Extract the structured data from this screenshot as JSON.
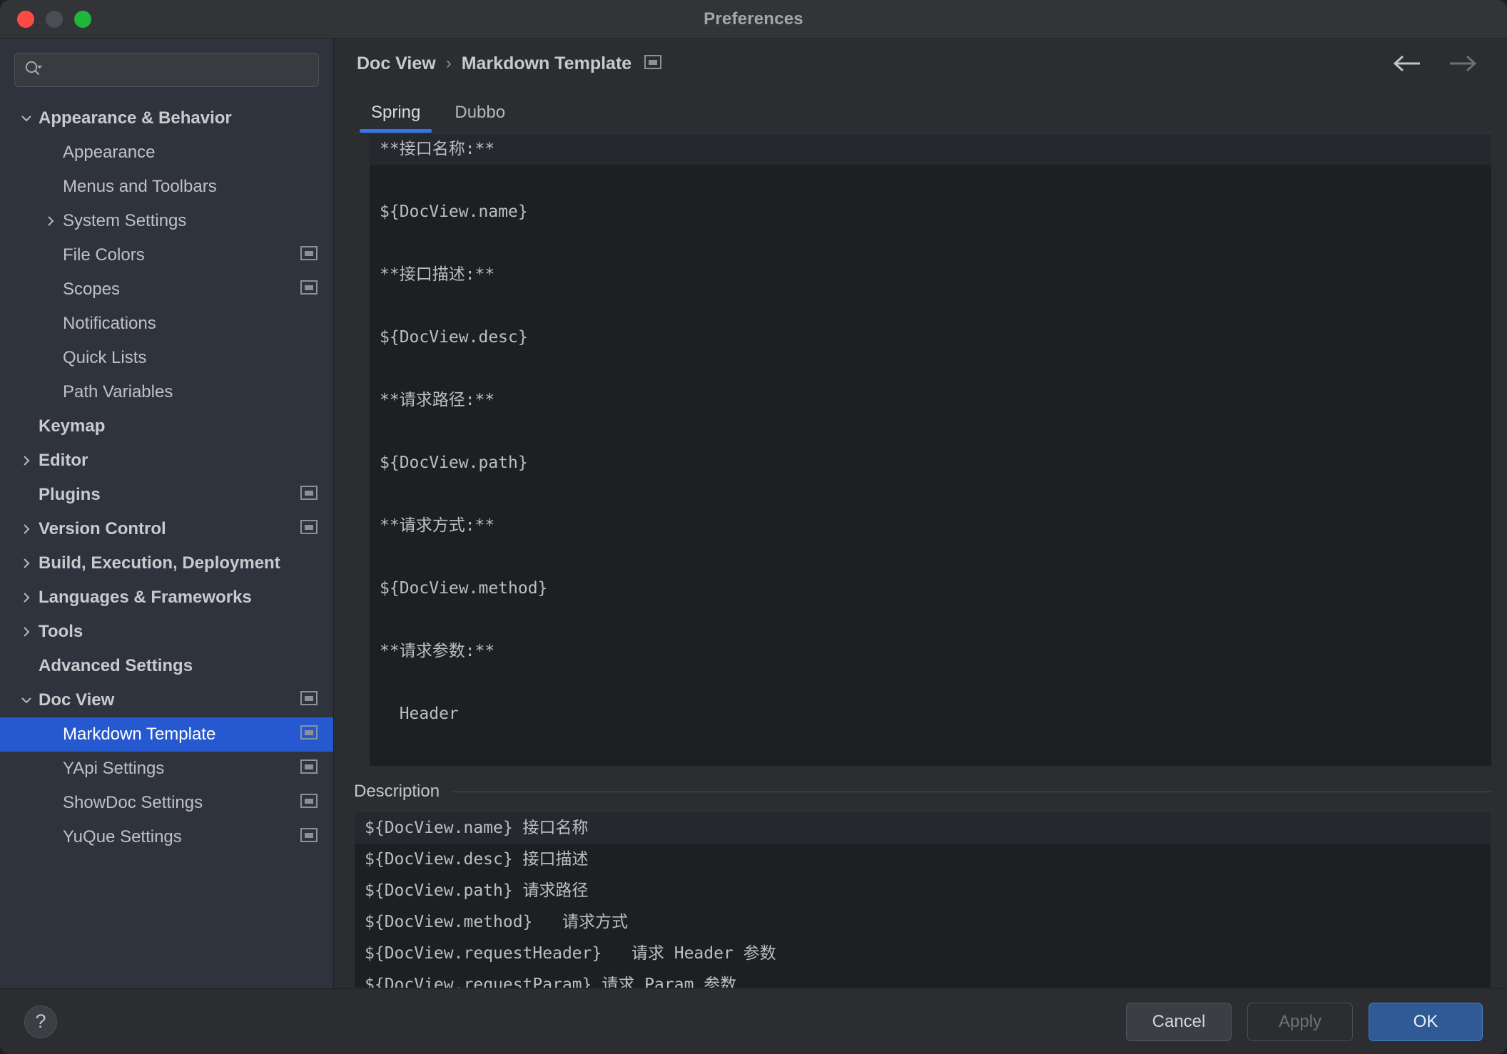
{
  "window": {
    "title": "Preferences",
    "traffic_lights": [
      "close",
      "minimize",
      "maximize"
    ]
  },
  "sidebar": {
    "search": {
      "value": "",
      "placeholder": ""
    },
    "items": [
      {
        "label": "Appearance & Behavior",
        "depth": 0,
        "chevron": "down",
        "icon": false,
        "selected": false
      },
      {
        "label": "Appearance",
        "depth": 1,
        "chevron": "none",
        "icon": false,
        "selected": false
      },
      {
        "label": "Menus and Toolbars",
        "depth": 1,
        "chevron": "none",
        "icon": false,
        "selected": false
      },
      {
        "label": "System Settings",
        "depth": 1,
        "chevron": "right",
        "icon": false,
        "selected": false
      },
      {
        "label": "File Colors",
        "depth": 1,
        "chevron": "none",
        "icon": true,
        "selected": false
      },
      {
        "label": "Scopes",
        "depth": 1,
        "chevron": "none",
        "icon": true,
        "selected": false
      },
      {
        "label": "Notifications",
        "depth": 1,
        "chevron": "none",
        "icon": false,
        "selected": false
      },
      {
        "label": "Quick Lists",
        "depth": 1,
        "chevron": "none",
        "icon": false,
        "selected": false
      },
      {
        "label": "Path Variables",
        "depth": 1,
        "chevron": "none",
        "icon": false,
        "selected": false
      },
      {
        "label": "Keymap",
        "depth": 0,
        "chevron": "none",
        "icon": false,
        "selected": false
      },
      {
        "label": "Editor",
        "depth": 0,
        "chevron": "right",
        "icon": false,
        "selected": false
      },
      {
        "label": "Plugins",
        "depth": 0,
        "chevron": "none",
        "icon": true,
        "selected": false
      },
      {
        "label": "Version Control",
        "depth": 0,
        "chevron": "right",
        "icon": true,
        "selected": false
      },
      {
        "label": "Build, Execution, Deployment",
        "depth": 0,
        "chevron": "right",
        "icon": false,
        "selected": false
      },
      {
        "label": "Languages & Frameworks",
        "depth": 0,
        "chevron": "right",
        "icon": false,
        "selected": false
      },
      {
        "label": "Tools",
        "depth": 0,
        "chevron": "right",
        "icon": false,
        "selected": false
      },
      {
        "label": "Advanced Settings",
        "depth": 0,
        "chevron": "none",
        "icon": false,
        "selected": false
      },
      {
        "label": "Doc View",
        "depth": 0,
        "chevron": "down",
        "icon": true,
        "selected": false
      },
      {
        "label": "Markdown Template",
        "depth": 1,
        "chevron": "none",
        "icon": true,
        "selected": true
      },
      {
        "label": "YApi Settings",
        "depth": 1,
        "chevron": "none",
        "icon": true,
        "selected": false
      },
      {
        "label": "ShowDoc Settings",
        "depth": 1,
        "chevron": "none",
        "icon": true,
        "selected": false
      },
      {
        "label": "YuQue Settings",
        "depth": 1,
        "chevron": "none",
        "icon": true,
        "selected": false
      }
    ]
  },
  "breadcrumb": {
    "root": "Doc View",
    "separator": "›",
    "leaf": "Markdown Template",
    "back_arrow": "←",
    "forward_arrow": "→"
  },
  "tabs": [
    {
      "label": "Spring",
      "active": true
    },
    {
      "label": "Dubbo",
      "active": false
    }
  ],
  "editor": {
    "lines": [
      {
        "text": "**接口名称:**",
        "current": true
      },
      {
        "text": "",
        "current": false
      },
      {
        "text": "${DocView.name}",
        "current": false
      },
      {
        "text": "",
        "current": false
      },
      {
        "text": "**接口描述:**",
        "current": false
      },
      {
        "text": "",
        "current": false
      },
      {
        "text": "${DocView.desc}",
        "current": false
      },
      {
        "text": "",
        "current": false
      },
      {
        "text": "**请求路径:**",
        "current": false
      },
      {
        "text": "",
        "current": false
      },
      {
        "text": "${DocView.path}",
        "current": false
      },
      {
        "text": "",
        "current": false
      },
      {
        "text": "**请求方式:**",
        "current": false
      },
      {
        "text": "",
        "current": false
      },
      {
        "text": "${DocView.method}",
        "current": false
      },
      {
        "text": "",
        "current": false
      },
      {
        "text": "**请求参数:**",
        "current": false
      },
      {
        "text": "",
        "current": false
      },
      {
        "text": "  Header",
        "current": false
      }
    ]
  },
  "description": {
    "title": "Description",
    "lines": [
      {
        "text": "${DocView.name} 接口名称",
        "current": true
      },
      {
        "text": "${DocView.desc} 接口描述",
        "current": false
      },
      {
        "text": "${DocView.path} 请求路径",
        "current": false
      },
      {
        "text": "${DocView.method}   请求方式",
        "current": false
      },
      {
        "text": "${DocView.requestHeader}   请求 Header 参数",
        "current": false
      },
      {
        "text": "${DocView.requestParam} 请求 Param 参数",
        "current": false
      }
    ]
  },
  "footer": {
    "help_label": "?",
    "cancel_label": "Cancel",
    "apply_label": "Apply",
    "ok_label": "OK"
  },
  "colors": {
    "accent": "#3574f0",
    "selection": "#2659cf",
    "primary_button": "#2f5a96",
    "sidebar_bg": "#2f333d",
    "panel_bg": "#2b2d30",
    "editor_bg": "#1e1f22",
    "close": "#fc4b45",
    "minimize": "#4a4d51",
    "maximize": "#1fb739"
  }
}
